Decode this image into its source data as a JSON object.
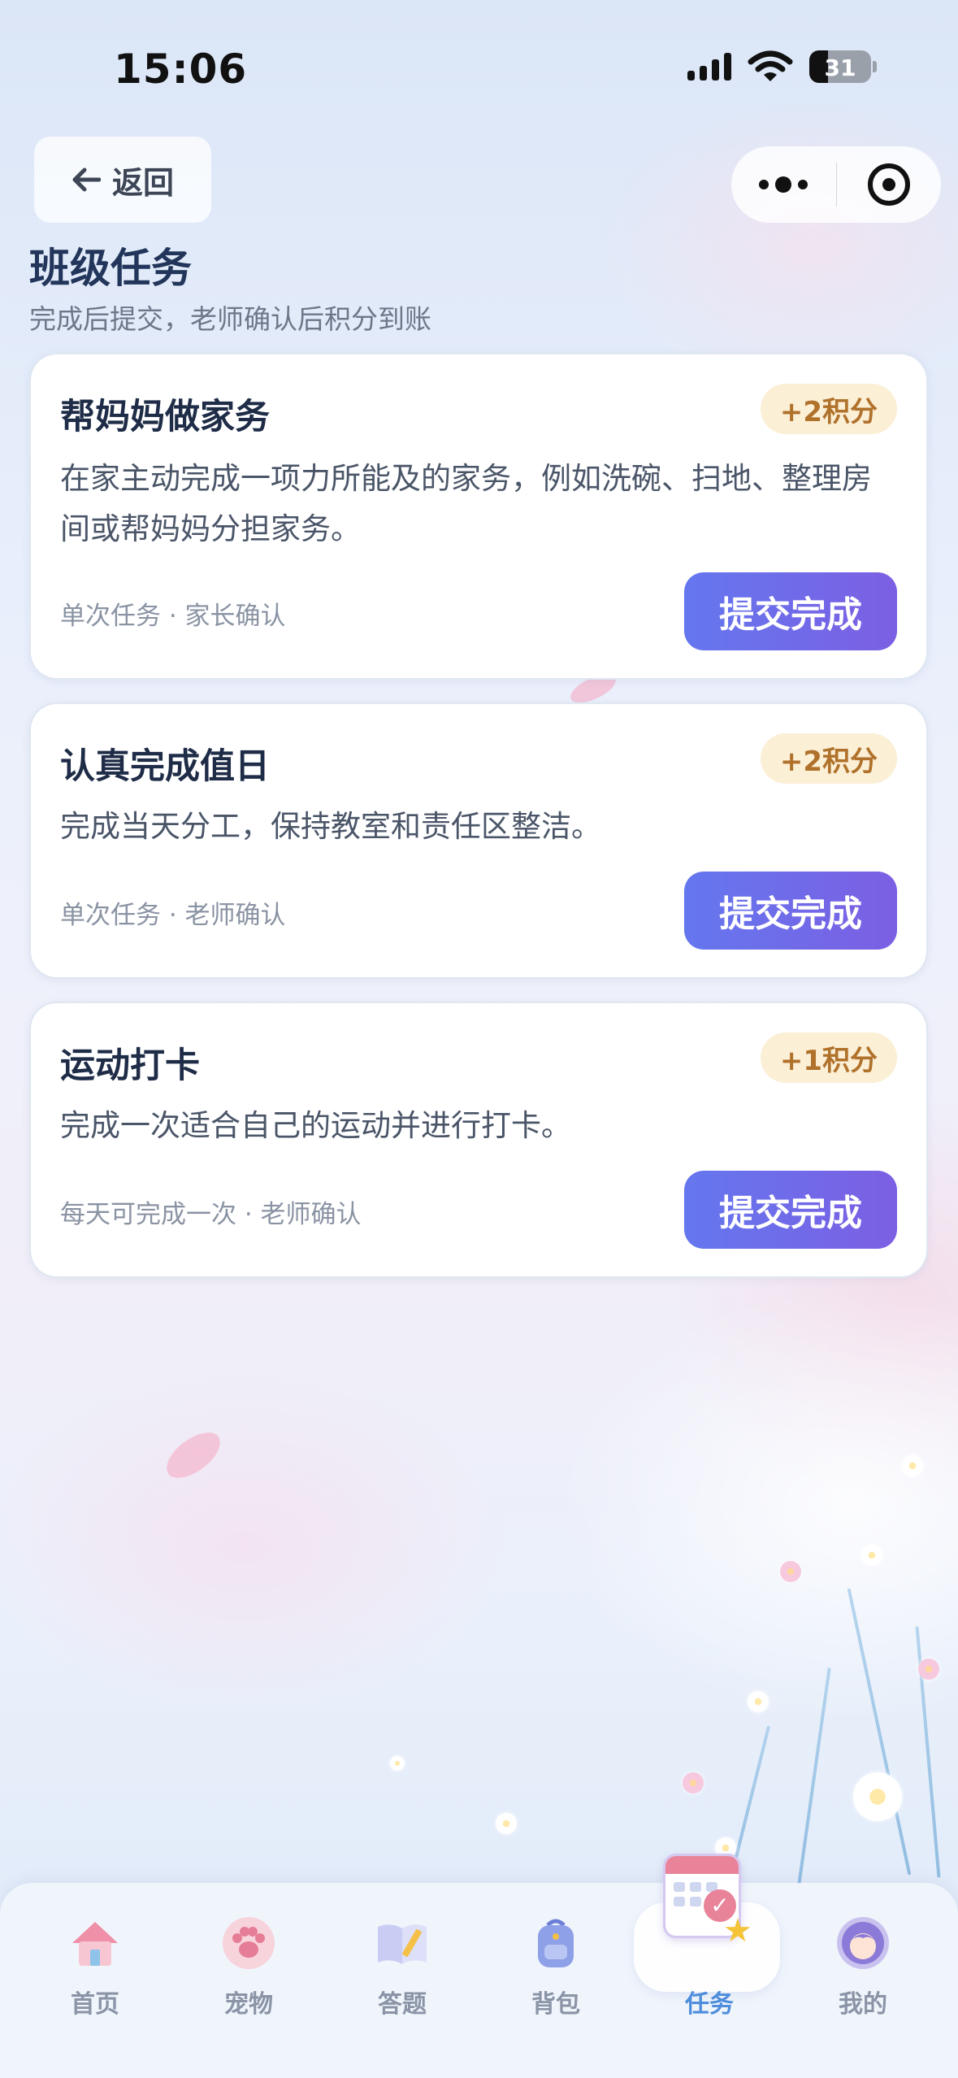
{
  "status_bar": {
    "time": "15:06",
    "battery_level": "31"
  },
  "nav": {
    "back_label": "返回"
  },
  "header": {
    "title": "班级任务",
    "subtitle": "完成后提交，老师确认后积分到账"
  },
  "tasks": [
    {
      "title": "帮妈妈做家务",
      "points": "+2积分",
      "description": "在家主动完成一项力所能及的家务，例如洗碗、扫地、整理房间或帮妈妈分担家务。",
      "meta": "单次任务 · 家长确认",
      "button": "提交完成"
    },
    {
      "title": "认真完成值日",
      "points": "+2积分",
      "description": "完成当天分工，保持教室和责任区整洁。",
      "meta": "单次任务 · 老师确认",
      "button": "提交完成"
    },
    {
      "title": "运动打卡",
      "points": "+1积分",
      "description": "完成一次适合自己的运动并进行打卡。",
      "meta": "每天可完成一次 · 老师确认",
      "button": "提交完成"
    }
  ],
  "tab_bar": {
    "items": [
      {
        "label": "首页",
        "icon": "house-icon"
      },
      {
        "label": "宠物",
        "icon": "paw-icon"
      },
      {
        "label": "答题",
        "icon": "book-pencil-icon"
      },
      {
        "label": "背包",
        "icon": "backpack-icon"
      },
      {
        "label": "任务",
        "icon": "calendar-check-icon",
        "active": true
      },
      {
        "label": "我的",
        "icon": "avatar-icon"
      }
    ]
  },
  "colors": {
    "accent_gradient_start": "#6477ee",
    "accent_gradient_end": "#7c5fe3",
    "points_badge_bg": "#fbefd6",
    "points_badge_text": "#b0712a",
    "active_tab_text": "#4d8ddc"
  }
}
